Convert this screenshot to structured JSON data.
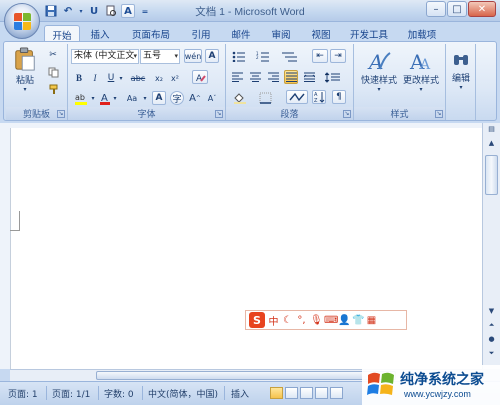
{
  "window": {
    "title": "文档 1 - Microsoft Word",
    "controls": [
      "–",
      "□",
      "✕"
    ]
  },
  "tabs": [
    {
      "label": "开始",
      "active": true
    },
    {
      "label": "插入"
    },
    {
      "label": "页面布局"
    },
    {
      "label": "引用"
    },
    {
      "label": "邮件"
    },
    {
      "label": "审阅"
    },
    {
      "label": "视图"
    },
    {
      "label": "开发工具"
    },
    {
      "label": "加载项"
    }
  ],
  "ribbon": {
    "clipboard": {
      "label": "剪贴板",
      "paste": "粘贴"
    },
    "font": {
      "label": "字体",
      "font_name": "宋体 (中文正文",
      "font_size": "五号",
      "icon_glyphs": {
        "bold": "B",
        "italic": "I",
        "underline": "U",
        "strike": "abc",
        "subscript": "x₂",
        "superscript": "x²",
        "font_color": "A",
        "change_case": "Aa",
        "grow": "A",
        "shrink": "A"
      }
    },
    "paragraph": {
      "label": "段落"
    },
    "styles": {
      "label": "样式",
      "quick_styles": "快速样式",
      "change_styles": "更改样式"
    },
    "editing": {
      "label": "编辑"
    }
  },
  "ime": {
    "mode": "中"
  },
  "status": {
    "page": "页面: 1",
    "pages": "页面: 1/1",
    "words": "字数: 0",
    "language": "中文(简体，中国)",
    "insert_mode": "插入"
  },
  "watermark": {
    "title": "纯净系统之家",
    "url": "www.ycwjzy.com"
  },
  "colors": {
    "ribbon_bg": "#dde8f6",
    "tab_text": "#15428b",
    "ime_accent": "#e8431e",
    "watermark_blue": "#0d4c91"
  }
}
